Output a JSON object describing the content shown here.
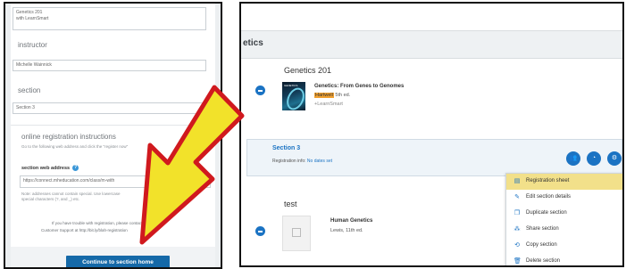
{
  "left": {
    "course_name_value": "Genetics 201",
    "course_name_value_line2": "with LearnSmart",
    "instructor_label": "instructor",
    "instructor_value": "Michelle Wainnick",
    "section_label": "section",
    "section_value": "Section 3",
    "online_reg_heading": "online registration instructions",
    "online_reg_desc": "Go to the following web address and click the \"register now\"",
    "section_web_address_label": "section web address",
    "section_web_address_value": "https://connect.mheducation.com/class/m-with",
    "fine_print_line1": "Note: addresses cannot contain special. Use lowercase",
    "fine_print_line2": "special characters (?, and _) etc.",
    "help_line1": "If you have trouble with registration, please contact",
    "help_line2": "Customer Support at http://bit.ly/blah-registration",
    "cta": "Continue to section home"
  },
  "right": {
    "header": "etics",
    "course1": {
      "title": "Genetics 201",
      "book_title": "Genetics: From Genes to Genomes",
      "author": "Hartwell",
      "edition": "5th ed.",
      "addon": "+LearnSmart",
      "cover_text": "GENETICS",
      "section_link": "Section 3",
      "reg_info_label": "Registration info:",
      "reg_info_link": "No dates set"
    },
    "menu": [
      {
        "icon": "registration-sheet-icon",
        "glyph": "▤",
        "label": "Registration sheet",
        "active": true
      },
      {
        "icon": "pencil-icon",
        "glyph": "✎",
        "label": "Edit section details",
        "active": false
      },
      {
        "icon": "duplicate-icon",
        "glyph": "❐",
        "label": "Duplicate section",
        "active": false
      },
      {
        "icon": "share-icon",
        "glyph": "⁂",
        "label": "Share section",
        "active": false
      },
      {
        "icon": "copy-icon",
        "glyph": "⟲",
        "label": "Copy section",
        "active": false
      },
      {
        "icon": "trash-icon",
        "glyph": "🗑",
        "label": "Delete section",
        "active": false
      }
    ],
    "course2": {
      "title": "test",
      "book_title": "Human Genetics",
      "author_edition": "Lewis, 11th ed."
    }
  },
  "colors": {
    "accent": "#1b73c3",
    "cta": "#1569a8",
    "arrow_fill": "#f2e22a",
    "arrow_stroke": "#d0191e",
    "menu_highlight": "#f2e08a",
    "author_highlight": "#f0a030"
  }
}
